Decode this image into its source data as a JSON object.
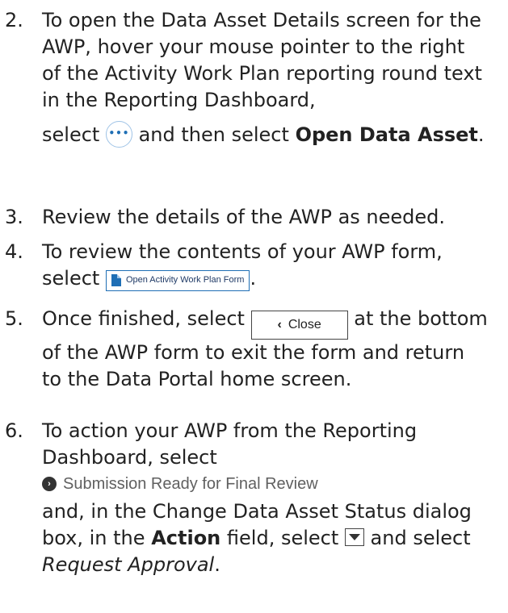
{
  "steps": [
    {
      "num": "2.",
      "text_a": "To open the Data Asset Details screen for the AWP, hover your mouse pointer to the right of the Activity Work Plan reporting round text in the Reporting Dashboard,",
      "text_b": "select",
      "text_c": "and then select",
      "bold_a": "Open Data Asset",
      "tail": "."
    },
    {
      "num": "3.",
      "text": "Review the details of the AWP as needed."
    },
    {
      "num": "4.",
      "text_a": "To review the contents of your AWP form,",
      "text_b": "select",
      "button_label": "Open Activity Work Plan Form",
      "tail": "."
    },
    {
      "num": "5.",
      "text_a": "Once finished, select",
      "button_label": "Close",
      "text_b": "at the bottom of the AWP form to exit the form and return to the Data Portal home screen."
    },
    {
      "num": "6.",
      "text_a": "To action your AWP from the Reporting Dashboard, select",
      "status_label": "Submission Ready for Final Review",
      "text_b": "and, in the Change Data Asset Status dialog box, in the",
      "bold_a": "Action",
      "text_c": "field, select",
      "text_d": "and select",
      "italic_a": "Request Approval",
      "tail": "."
    }
  ],
  "icons": {
    "more": "ellipsis-icon",
    "document": "document-icon",
    "close": "chevron-left-icon",
    "status": "circle-chevron-right-icon",
    "dropdown": "chevron-down-icon"
  }
}
